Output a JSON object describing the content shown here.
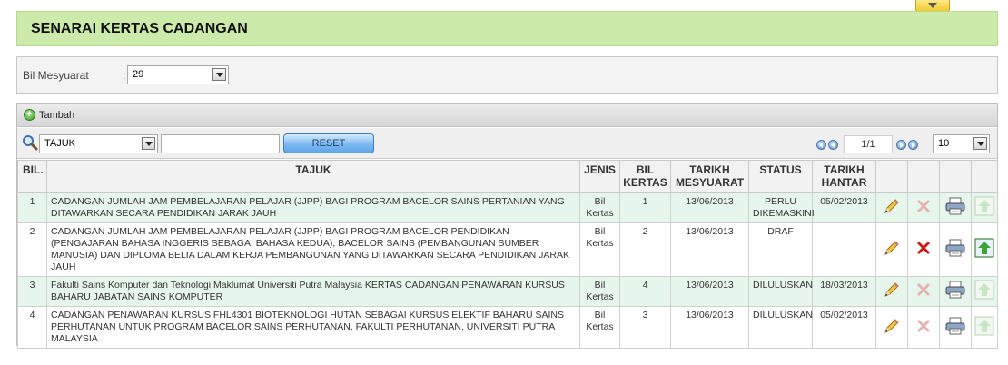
{
  "page": {
    "title": "SENARAI KERTAS CADANGAN"
  },
  "filter": {
    "label": "Bil Mesyuarat",
    "colon": ":",
    "value": "29"
  },
  "toolbar": {
    "add_label": "Tambah"
  },
  "search": {
    "field_value": "TAJUK",
    "input_value": "",
    "reset_label": "RESET"
  },
  "pager": {
    "page_label": "1/1",
    "page_size": "10"
  },
  "table": {
    "headers": {
      "bil": "BIL.",
      "tajuk": "TAJUK",
      "jenis": "JENIS",
      "bil_kertas_1": "BIL",
      "bil_kertas_2": "KERTAS",
      "tarikh_mesyuarat_1": "TARIKH",
      "tarikh_mesyuarat_2": "MESYUARAT",
      "status": "STATUS",
      "tarikh_hantar_1": "TARIKH",
      "tarikh_hantar_2": "HANTAR"
    },
    "rows": [
      {
        "bil": "1",
        "tajuk": "CADANGAN JUMLAH JAM PEMBELAJARAN PELAJAR (JJPP) BAGI PROGRAM BACELOR SAINS PERTANIAN YANG DITAWARKAN SECARA PENDIDIKAN JARAK JAUH",
        "jenis": "Bil Kertas",
        "bil_kertas": "1",
        "tarikh_mesyuarat": "13/06/2013",
        "status": "PERLU DIKEMASKINI",
        "tarikh_hantar": "05/02/2013"
      },
      {
        "bil": "2",
        "tajuk": "CADANGAN JUMLAH JAM PEMBELAJARAN PELAJAR (JJPP) BAGI PROGRAM BACELOR PENDIDIKAN (PENGAJARAN BAHASA INGGERIS SEBAGAI BAHASA KEDUA), BACELOR SAINS (PEMBANGUNAN SUMBER MANUSIA) DAN DIPLOMA BELIA DALAM KERJA PEMBANGUNAN YANG DITAWARKAN SECARA PENDIDIKAN JARAK JAUH",
        "jenis": "Bil Kertas",
        "bil_kertas": "2",
        "tarikh_mesyuarat": "13/06/2013",
        "status": "DRAF",
        "tarikh_hantar": ""
      },
      {
        "bil": "3",
        "tajuk": "Fakulti Sains Komputer dan Teknologi Maklumat Universiti Putra Malaysia KERTAS CADANGAN PENAWARAN KURSUS BAHARU JABATAN SAINS KOMPUTER",
        "jenis": "Bil Kertas",
        "bil_kertas": "4",
        "tarikh_mesyuarat": "13/06/2013",
        "status": "DILULUSKAN",
        "tarikh_hantar": "18/03/2013"
      },
      {
        "bil": "4",
        "tajuk": "CADANGAN PENAWARAN KURSUS FHL4301 BIOTEKNOLOGI HUTAN SEBAGAI KURSUS ELEKTIF BAHARU SAINS PERHUTANAN UNTUK PROGRAM BACELOR SAINS PERHUTANAN, FAKULTI PERHUTANAN, UNIVERSITI PUTRA MALAYSIA",
        "jenis": "Bil Kertas",
        "bil_kertas": "3",
        "tarikh_mesyuarat": "13/06/2013",
        "status": "DILULUSKAN",
        "tarikh_hantar": "05/02/2013"
      }
    ]
  },
  "icons": {
    "edit": "pencil-icon",
    "delete": "delete-x-icon",
    "print": "printer-icon",
    "submit": "upload-icon"
  },
  "colors": {
    "header_bg": "#ccebaa",
    "row_alt_bg": "#e7f6ec",
    "delete_active": "#cc1a1a",
    "delete_disabled": "#e2b3b3",
    "reset_button": "#7db9f2"
  }
}
